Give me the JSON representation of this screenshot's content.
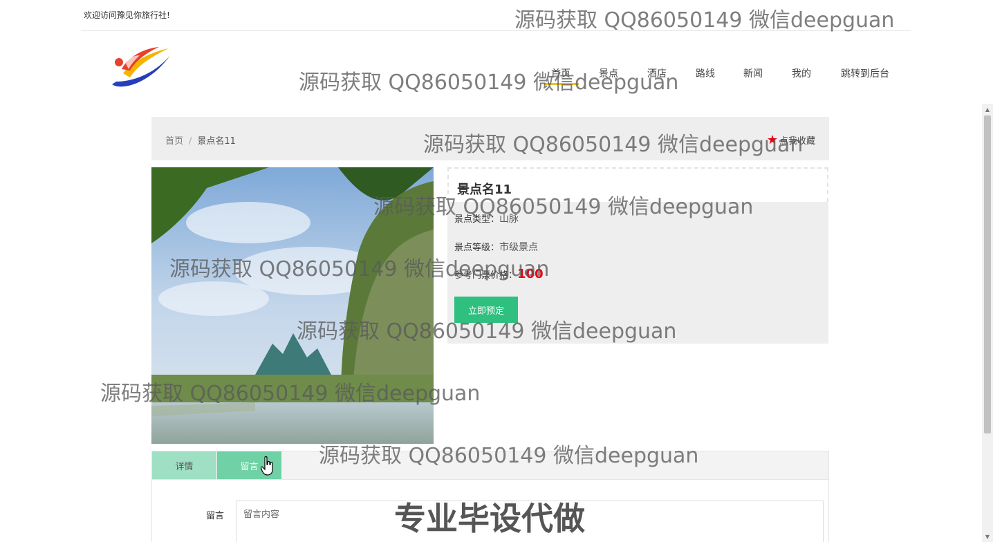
{
  "topbar": {
    "welcome": "欢迎访问豫见你旅行社!"
  },
  "nav": {
    "items": [
      {
        "label": "首页"
      },
      {
        "label": "景点"
      },
      {
        "label": "酒店"
      },
      {
        "label": "路线"
      },
      {
        "label": "新闻"
      },
      {
        "label": "我的"
      },
      {
        "label": "跳转到后台"
      }
    ],
    "active_color": "#f0c419"
  },
  "breadcrumb": {
    "home": "首页",
    "separator": "/",
    "current": "景点名11"
  },
  "favorite": {
    "label": "点我收藏",
    "icon": "star-icon",
    "color": "#e60012"
  },
  "detail": {
    "title": "景点名11",
    "type_label": "景点类型：",
    "type_value": "山脉",
    "level_label": "景点等级：",
    "level_value": "市级景点",
    "price_label": "参考门票价格：",
    "price_value": "100",
    "book_button": "立即预定",
    "accent": "#2fbf7f"
  },
  "tabs": [
    {
      "label": "详情"
    },
    {
      "label": "留言"
    }
  ],
  "comment_form": {
    "label": "留言",
    "placeholder": "留言内容"
  },
  "watermarks": {
    "text": "源码获取 QQ86050149 微信deepguan",
    "big": "专业毕设代做"
  }
}
